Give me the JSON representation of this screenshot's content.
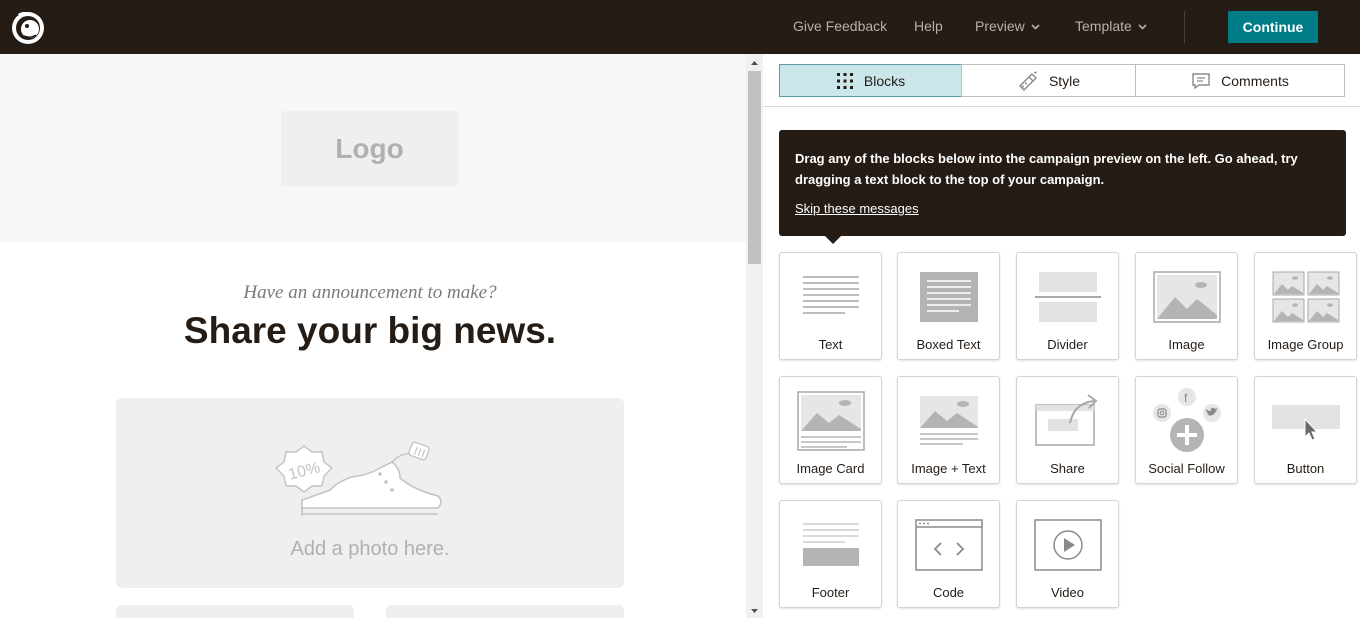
{
  "topbar": {
    "nav": {
      "give_feedback": "Give Feedback",
      "help": "Help",
      "preview": "Preview",
      "template": "Template"
    },
    "continue_label": "Continue",
    "colors": {
      "bar": "#241c15",
      "accent": "#007c89"
    }
  },
  "preview": {
    "logo_placeholder": "Logo",
    "kicker": "Have an announcement to make?",
    "headline": "Share your big news.",
    "photo_placeholder": "Add a photo here.",
    "badge": "10%"
  },
  "panel": {
    "tabs": [
      {
        "label": "Blocks",
        "icon": "grid-icon",
        "active": true
      },
      {
        "label": "Style",
        "icon": "paint-icon",
        "active": false
      },
      {
        "label": "Comments",
        "icon": "comment-icon",
        "active": false
      }
    ],
    "tip": {
      "text": "Drag any of the blocks below into the campaign preview on the left. Go ahead, try dragging a text block to the top of your campaign.",
      "link": "Skip these messages"
    },
    "blocks": [
      {
        "label": "Text",
        "icon": "text-block-icon"
      },
      {
        "label": "Boxed Text",
        "icon": "boxed-text-block-icon"
      },
      {
        "label": "Divider",
        "icon": "divider-block-icon"
      },
      {
        "label": "Image",
        "icon": "image-block-icon"
      },
      {
        "label": "Image Group",
        "icon": "image-group-block-icon"
      },
      {
        "label": "Image Card",
        "icon": "image-card-block-icon"
      },
      {
        "label": "Image + Text",
        "icon": "image-text-block-icon"
      },
      {
        "label": "Share",
        "icon": "share-block-icon"
      },
      {
        "label": "Social Follow",
        "icon": "social-follow-block-icon"
      },
      {
        "label": "Button",
        "icon": "button-block-icon"
      },
      {
        "label": "Footer",
        "icon": "footer-block-icon"
      },
      {
        "label": "Code",
        "icon": "code-block-icon"
      },
      {
        "label": "Video",
        "icon": "video-block-icon"
      }
    ]
  }
}
